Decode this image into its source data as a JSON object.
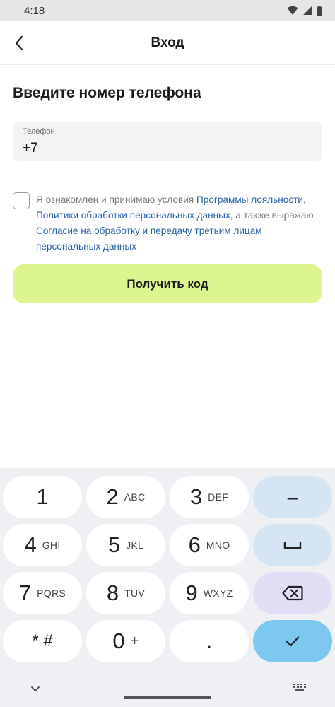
{
  "status_bar": {
    "time": "4:18",
    "icons": [
      "wifi-icon",
      "signal-icon",
      "battery-icon"
    ]
  },
  "app_bar": {
    "title": "Вход",
    "back_icon": "chevron-left-icon"
  },
  "heading": "Введите номер телефона",
  "phone_field": {
    "label": "Телефон",
    "value": "+7"
  },
  "consent": {
    "checked": false,
    "text_1": "Я ознакомлен и принимаю условия ",
    "link_1": "Программы лояльности",
    "text_2": ", ",
    "link_2": "Политики обработки персональных данных",
    "text_3": ", а также выражаю ",
    "link_3": "Согласие на обработку и передачу третьим лицам персональных данных"
  },
  "submit_button": {
    "label": "Получить код"
  },
  "keyboard": {
    "keys": [
      {
        "num": "1",
        "letters": ""
      },
      {
        "num": "2",
        "letters": "ABC"
      },
      {
        "num": "3",
        "letters": "DEF"
      },
      {
        "num": "4",
        "letters": "GHI"
      },
      {
        "num": "5",
        "letters": "JKL"
      },
      {
        "num": "6",
        "letters": "MNO"
      },
      {
        "num": "7",
        "letters": "PQRS"
      },
      {
        "num": "8",
        "letters": "TUV"
      },
      {
        "num": "9",
        "letters": "WXYZ"
      },
      {
        "num": "* #",
        "letters": ""
      },
      {
        "num": "0",
        "letters": "+"
      },
      {
        "num": ".",
        "letters": ""
      }
    ],
    "side_keys": {
      "minus": "–",
      "space_icon": "space-icon",
      "delete_icon": "backspace-icon",
      "done_icon": "checkmark-icon"
    },
    "colors": {
      "background": "#eef0f4",
      "key": "#ffffff",
      "side_key": "#d5e5f4",
      "delete_key": "#e3ddf6",
      "done_key": "#7cc8ef"
    }
  },
  "colors": {
    "accent_button": "#dcf58e",
    "link": "#2c62a8",
    "field_bg": "#f3f4f6"
  }
}
